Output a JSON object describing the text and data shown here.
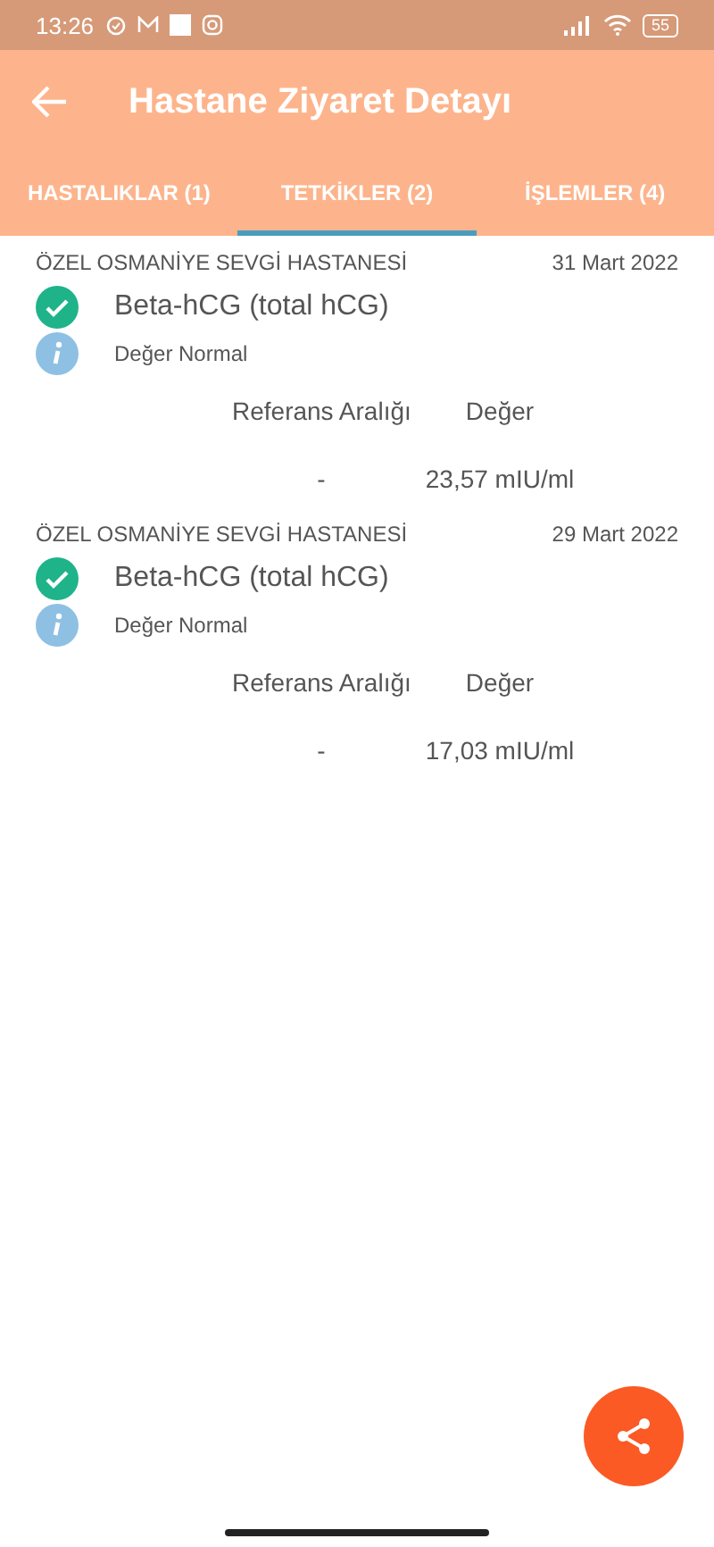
{
  "status_bar": {
    "time": "13:26",
    "battery": "55"
  },
  "app_bar": {
    "title": "Hastane Ziyaret Detayı"
  },
  "tabs": [
    {
      "label": "HASTALIKLAR (1)",
      "selected": false
    },
    {
      "label": "TETKİKLER (2)",
      "selected": true
    },
    {
      "label": "İŞLEMLER (4)",
      "selected": false
    }
  ],
  "tests": [
    {
      "hospital": "ÖZEL OSMANİYE SEVGİ HASTANESİ",
      "date": "31 Mart 2022",
      "name": "Beta-hCG (total hCG)",
      "status": "Değer Normal",
      "ref_header": "Referans Aralığı",
      "value_header": "Değer",
      "ref": "-",
      "value": "23,57 mIU/ml"
    },
    {
      "hospital": "ÖZEL OSMANİYE SEVGİ HASTANESİ",
      "date": "29 Mart 2022",
      "name": "Beta-hCG (total hCG)",
      "status": "Değer Normal",
      "ref_header": "Referans Aralığı",
      "value_header": "Değer",
      "ref": "-",
      "value": "17,03 mIU/ml"
    }
  ]
}
